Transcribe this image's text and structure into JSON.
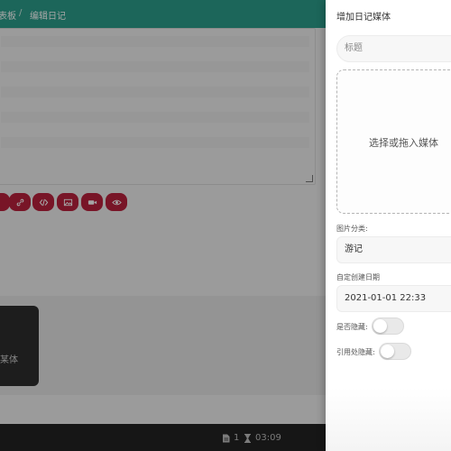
{
  "breadcrumb": {
    "prev": "表板",
    "separator": "/",
    "current": "编辑日记"
  },
  "toolbar": {
    "buttons": [
      {
        "icon": "partial-button-icon"
      },
      {
        "icon": "link-icon"
      },
      {
        "icon": "code-icon"
      },
      {
        "icon": "image-icon"
      },
      {
        "icon": "video-icon"
      },
      {
        "icon": "eye-icon"
      }
    ],
    "accent_color": "#b9213c"
  },
  "background_card": {
    "text": "某体"
  },
  "footer": {
    "page_count": "1",
    "time": "03:09"
  },
  "drawer": {
    "title": "增加日记媒体",
    "title_placeholder": "标题",
    "dropzone_text": "选择或拖入媒体",
    "category_label": "图片分类:",
    "category_value": "游记",
    "date_label": "自定创建日期",
    "date_value": "2021-01-01 22:33",
    "hidden_label": "是否隐藏:",
    "hidden_value": false,
    "ref_hidden_label": "引用处隐藏:",
    "ref_hidden_value": false
  },
  "colors": {
    "topbar": "#2c9d8a",
    "footer": "#222222"
  }
}
